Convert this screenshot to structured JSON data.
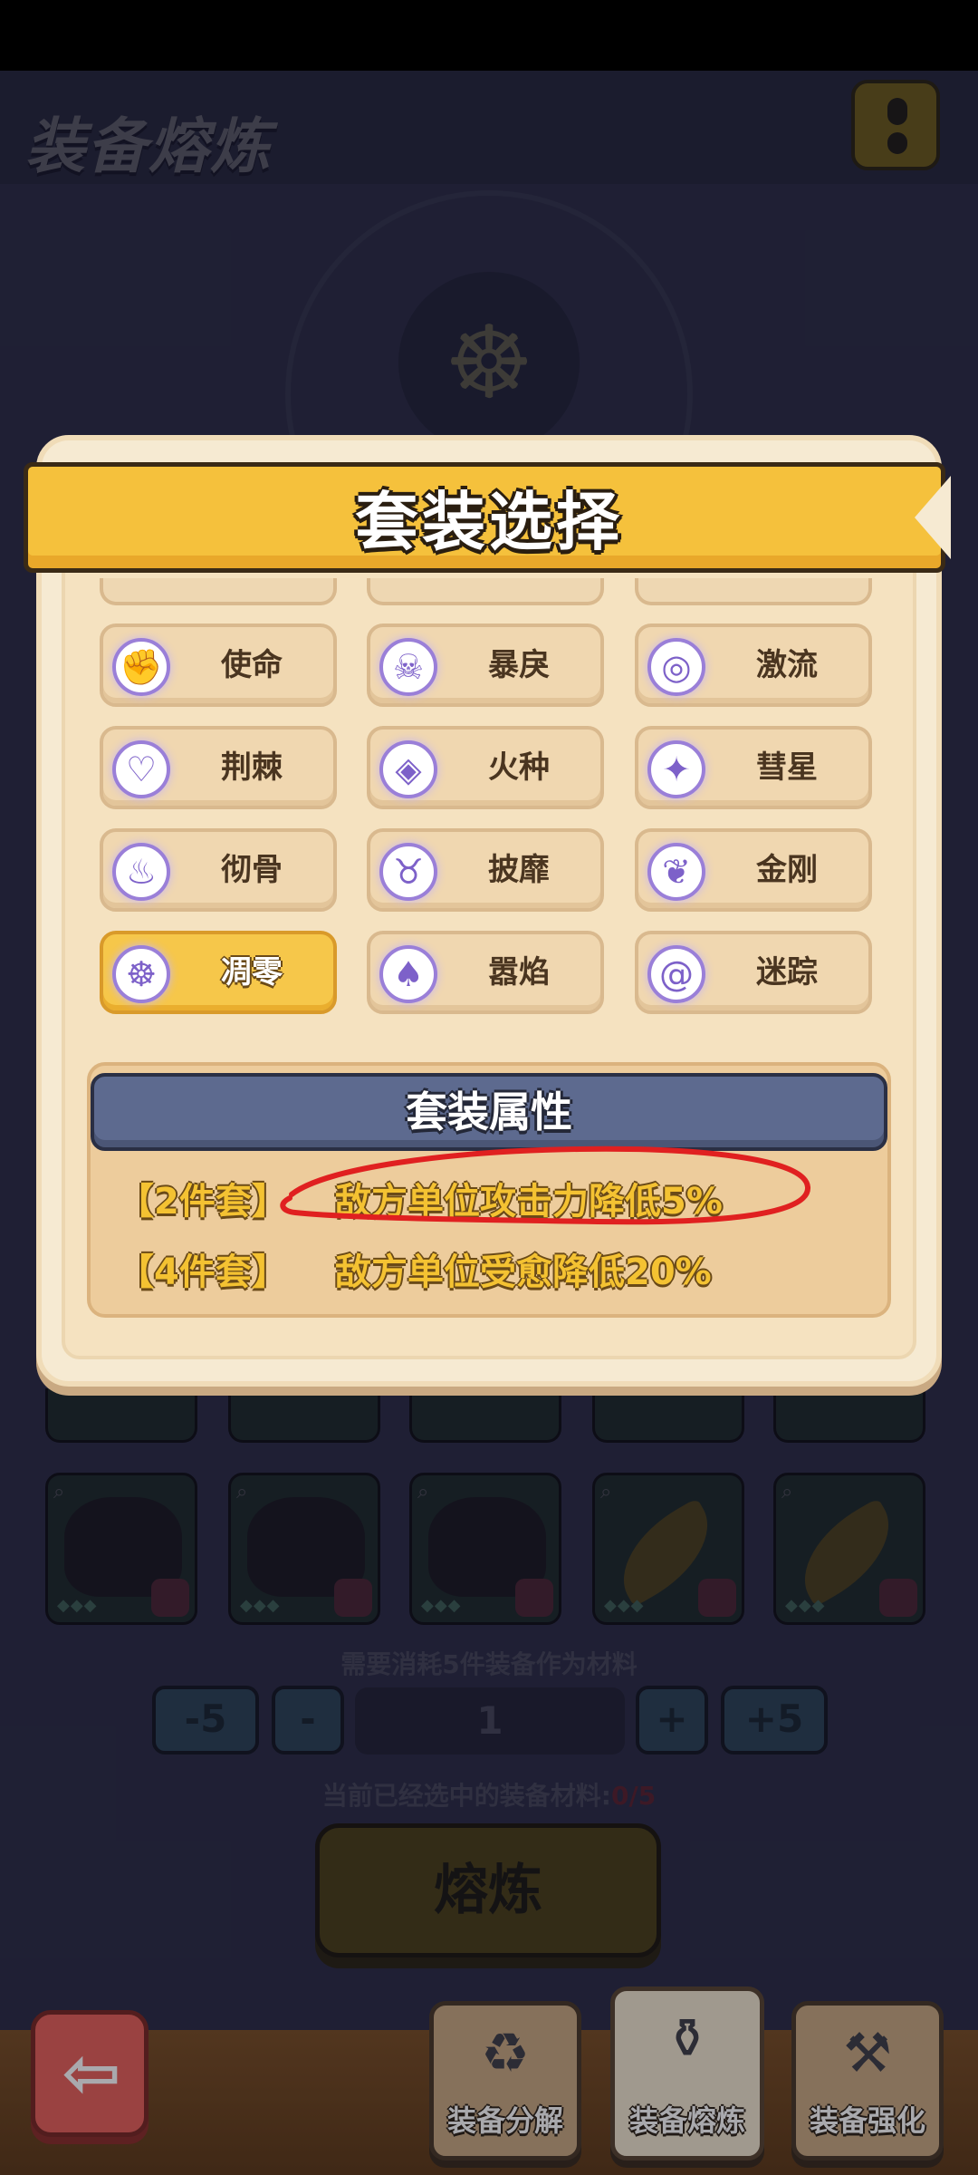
{
  "header": {
    "title": "装备熔炼"
  },
  "dialog": {
    "title": "套装选择",
    "sets": [
      {
        "label": "使命",
        "icon": "fist-icon"
      },
      {
        "label": "暴戾",
        "icon": "demon-mask-icon"
      },
      {
        "label": "激流",
        "icon": "vortex-icon"
      },
      {
        "label": "荆棘",
        "icon": "heart-thorn-icon"
      },
      {
        "label": "火种",
        "icon": "eye-flame-icon"
      },
      {
        "label": "彗星",
        "icon": "comet-star-icon"
      },
      {
        "label": "彻骨",
        "icon": "bone-flame-icon"
      },
      {
        "label": "披靡",
        "icon": "horned-skull-icon"
      },
      {
        "label": "金刚",
        "icon": "lotus-drop-icon"
      },
      {
        "label": "凋零",
        "icon": "triskelion-icon",
        "selected": true
      },
      {
        "label": "嚣焰",
        "icon": "blaze-icon"
      },
      {
        "label": "迷踪",
        "icon": "spiral-icon"
      }
    ],
    "attributes": {
      "title": "套装属性",
      "rows": [
        {
          "tier": "【2件套】",
          "desc": "敌方单位攻击力降低5%"
        },
        {
          "tier": "【4件套】",
          "desc": "敌方单位受愈降低20%"
        }
      ]
    }
  },
  "material": {
    "need_text": "需要消耗5件装备作为材料",
    "minus5": "-5",
    "minus": "-",
    "quantity": "1",
    "plus": "+",
    "plus5": "+5",
    "selected_prefix": "当前已经选中的装备材料:",
    "selected_count": "0/5",
    "smelt_label": "熔炼"
  },
  "tabs": [
    {
      "label": "装备分解",
      "icon": "recycle-icon"
    },
    {
      "label": "装备熔炼",
      "icon": "furnace-icon",
      "active": true
    },
    {
      "label": "装备强化",
      "icon": "anvil-icon"
    }
  ],
  "colors": {
    "accent_gold": "#f5c13c",
    "set_text_gold": "#f4c232",
    "annotation_red": "#e02020",
    "header_slate": "#5d6a8f"
  }
}
